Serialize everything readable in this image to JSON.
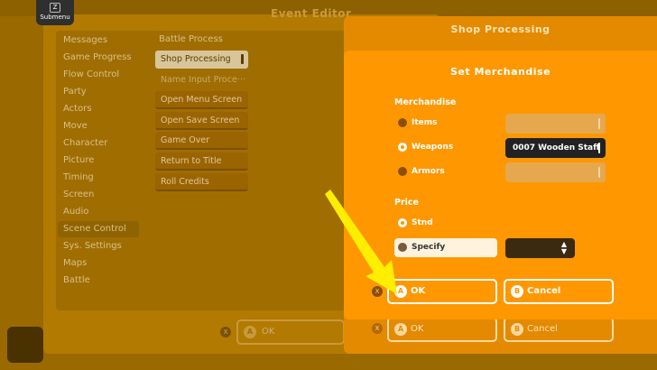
{
  "submenu": {
    "label": "Submenu",
    "icon_glyph": "Z"
  },
  "event_editor": {
    "title": "Event Editor",
    "categories": [
      "Messages",
      "Game Progress",
      "Flow Control",
      "Party",
      "Actors",
      "Move",
      "Character",
      "Picture",
      "Timing",
      "Screen",
      "Audio",
      "Scene Control",
      "Sys. Settings",
      "Maps",
      "Battle"
    ],
    "active_category": "Scene Control",
    "commands": [
      "Battle Process",
      "Shop Processing",
      "Name Input Proce···",
      "Open Menu Screen",
      "Open Save Screen",
      "Game Over",
      "Return to Title",
      "Roll Credits"
    ],
    "active_command": "Shop Processing",
    "ok_label": "OK",
    "ok_badge": "A",
    "x_badge": "X"
  },
  "shop_dialog": {
    "title": "Shop Processing",
    "ok_label": "OK",
    "ok_badge": "A",
    "cancel_label": "Cancel",
    "cancel_badge": "B",
    "x_badge": "X"
  },
  "merch_dialog": {
    "title": "Set Merchandise",
    "merchandise_label": "Merchandise",
    "options": [
      {
        "label": "Items",
        "selected": false,
        "value": ""
      },
      {
        "label": "Weapons",
        "selected": true,
        "value": "0007 Wooden Staff"
      },
      {
        "label": "Armors",
        "selected": false,
        "value": ""
      }
    ],
    "price_label": "Price",
    "price_options": [
      {
        "label": "Stnd",
        "selected": true
      },
      {
        "label": "Specify",
        "selected": false
      }
    ],
    "spin_arrows": "▲▼",
    "ok_label": "OK",
    "ok_badge": "A",
    "cancel_label": "Cancel",
    "cancel_badge": "B",
    "x_badge": "X"
  },
  "colors": {
    "accent": "#ff9800",
    "highlight_arrow": "#ffee00"
  }
}
